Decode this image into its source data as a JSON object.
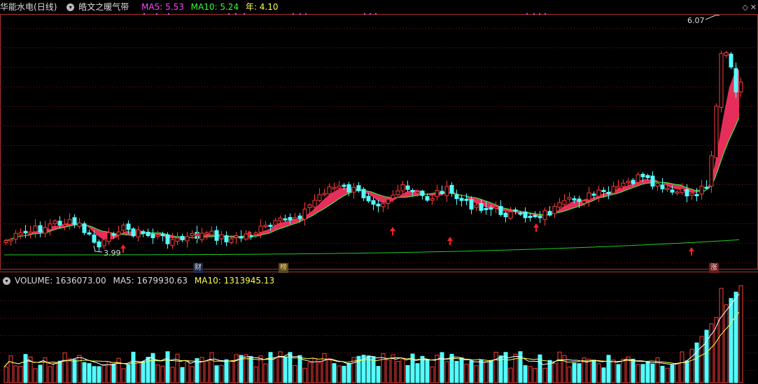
{
  "main_chart": {
    "stock_name": "华能水电",
    "period": "(日线)",
    "indicator_name": "皓文之暖气带",
    "ma5_text": "MA5: 5.53",
    "ma10_text": "MA10: 5.24",
    "year_text": "年: 4.10",
    "high_label": "6.07",
    "low_label": "3.99",
    "colors": {
      "ma5": "#ff44ff",
      "ma10": "#33ff33",
      "year": "#ffff55",
      "up": "#ff3b3b",
      "down": "#54ffff",
      "band": "#ff3366",
      "grid": "#7a1a1a"
    }
  },
  "markers": {
    "cai": "财",
    "bang": "榜",
    "zhang": "涨"
  },
  "volume_panel": {
    "label_text": "VOLUME: 1636073.00",
    "ma5_text": "MA5: 1679930.63",
    "ma10_text": "MA10: 1313945.13"
  },
  "icons": {
    "dropdown": "chevron-down-icon",
    "settings": "diamond-icon",
    "close": "close-icon"
  }
}
